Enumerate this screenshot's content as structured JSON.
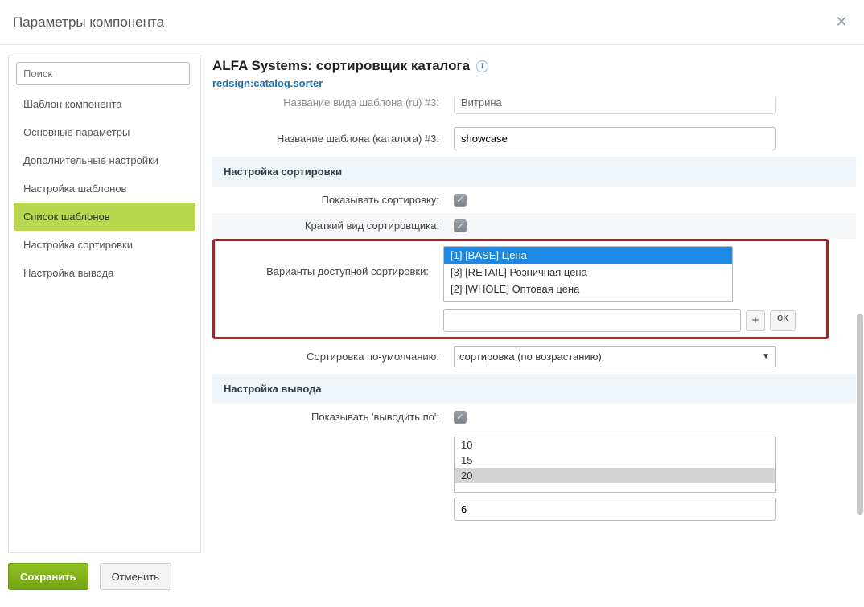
{
  "dialog": {
    "title": "Параметры компонента"
  },
  "sidebar": {
    "search_placeholder": "Поиск",
    "items": [
      {
        "label": "Шаблон компонента"
      },
      {
        "label": "Основные параметры"
      },
      {
        "label": "Дополнительные настройки"
      },
      {
        "label": "Настройка шаблонов"
      },
      {
        "label": "Список шаблонов"
      },
      {
        "label": "Настройка сортировки"
      },
      {
        "label": "Настройка вывода"
      }
    ]
  },
  "main": {
    "title": "ALFA Systems: сортировщик каталога",
    "subtitle": "redsign:catalog.sorter"
  },
  "rows": {
    "tpl_name_ru_label": "Название вида шаблона (ru) #3:",
    "tpl_name_ru_value": "Витрина",
    "tpl_name_catalog_label": "Название шаблона (каталога) #3:",
    "tpl_name_catalog_value": "showcase"
  },
  "sections": {
    "sort_settings": "Настройка сортировки",
    "output_settings": "Настройка вывода"
  },
  "sort": {
    "show_sort_label": "Показывать сортировку:",
    "short_view_label": "Краткий вид сортировщика:",
    "variants_label": "Варианты доступной сортировки:",
    "variants": [
      "[1] [BASE] Цена",
      "[3] [RETAIL] Розничная цена",
      "[2] [WHOLE] Оптовая цена"
    ],
    "default_label": "Сортировка по-умолчанию:",
    "default_value": "сортировка (по возрастанию)",
    "add_btn": "+",
    "ok_btn": "ok"
  },
  "output": {
    "show_output_label": "Показывать 'выводить по':",
    "counts": [
      "10",
      "15",
      "20"
    ],
    "extra_input": "6"
  },
  "footer": {
    "save": "Сохранить",
    "cancel": "Отменить"
  }
}
